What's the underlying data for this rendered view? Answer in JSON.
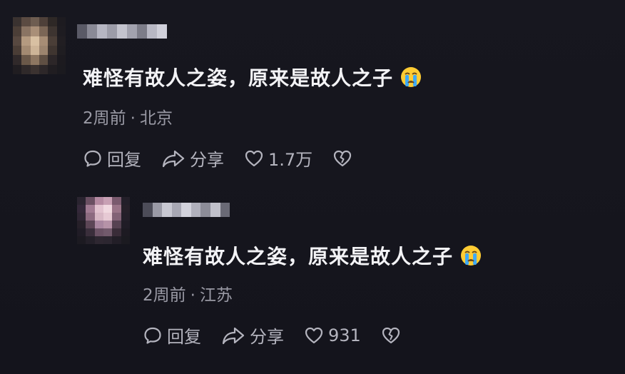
{
  "comments": [
    {
      "text": "难怪有故人之姿，原来是故人之子",
      "emoji": "crying-face-icon",
      "time": "2周前",
      "separator": "·",
      "location": "北京",
      "reply_label": "回复",
      "share_label": "分享",
      "like_count": "1.7万"
    },
    {
      "text": "难怪有故人之姿，原来是故人之子",
      "emoji": "crying-face-icon",
      "time": "2周前",
      "separator": "·",
      "location": "江苏",
      "reply_label": "回复",
      "share_label": "分享",
      "like_count": "931"
    }
  ],
  "colors": {
    "background": "#16161f",
    "text": "#f3f3f6",
    "meta": "#9a9aa5",
    "action": "#b4b4be"
  }
}
